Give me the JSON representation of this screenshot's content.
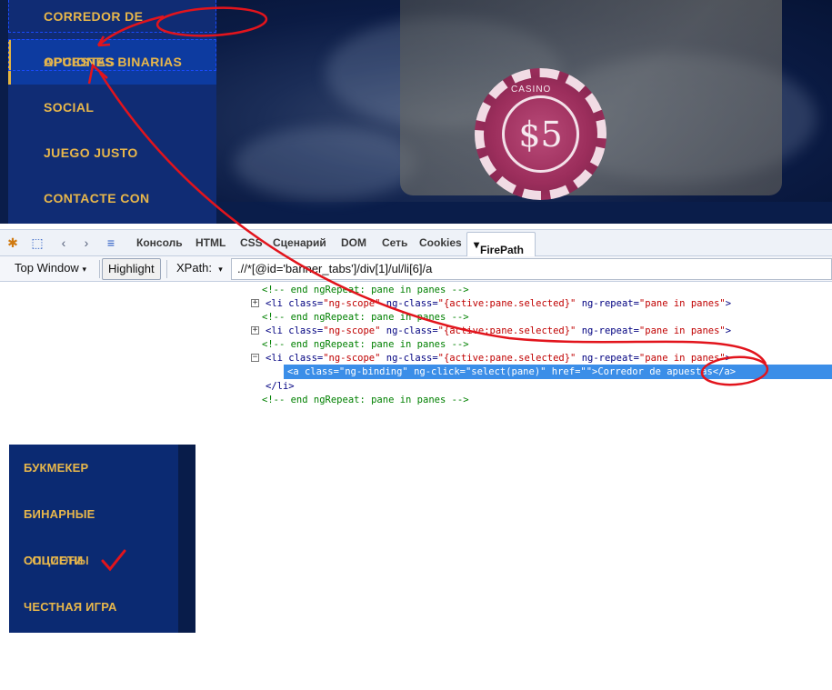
{
  "banner": {
    "nav_items": [
      {
        "label": "CORREDOR DE"
      },
      {
        "label": "OPCIONES BINARIAS"
      },
      {
        "label": "SOCIAL"
      },
      {
        "label": "JUEGO JUSTO"
      },
      {
        "label": "CONTACTE CON"
      }
    ],
    "overlap_text": "APUESTAS",
    "chip_text": "CASINO",
    "chip_value": "$5"
  },
  "devtools": {
    "tabs": [
      "Консоль",
      "HTML",
      "CSS",
      "Сценарий",
      "DOM",
      "Сеть",
      "Cookies"
    ],
    "active_tab": "FirePath",
    "toolbar": {
      "window_select": "Top Window",
      "highlight_label": "Highlight",
      "xpath_label": "XPath:",
      "xpath_value": ".//*[@id='banner_tabs']/div[1]/ul/li[6]/a"
    },
    "code": {
      "comment": "<!-- end ngRepeat: pane in panes -->",
      "li_open_a": "<li class=",
      "li_class_val": "\"ng-scope\"",
      "li_ngclass_attr": " ng-class=",
      "li_ngclass_val": "\"{active:pane.selected}\"",
      "li_repeat_attr": " ng-repeat=",
      "li_repeat_val": "\"pane in panes\"",
      "li_close": ">",
      "selected_line": "<a class=\"ng-binding\" ng-click=\"select(pane)\" href=\"\">Corredor de apuestas</a>",
      "li_end": "</li>"
    }
  },
  "ru_nav": {
    "items": [
      {
        "label": "БУКМЕКЕР"
      },
      {
        "label": "БИНАРНЫЕ"
      },
      {
        "label": "СОЦСЕТИ"
      },
      {
        "label": "ЧЕСТНАЯ ИГРА"
      }
    ],
    "overlap_text": "ОПЦИОНЫ"
  },
  "colors": {
    "nav_gold": "#e8b74b",
    "nav_blue": "#102c74",
    "selection": "#3b8ee8",
    "annotation_red": "#e2141c"
  }
}
